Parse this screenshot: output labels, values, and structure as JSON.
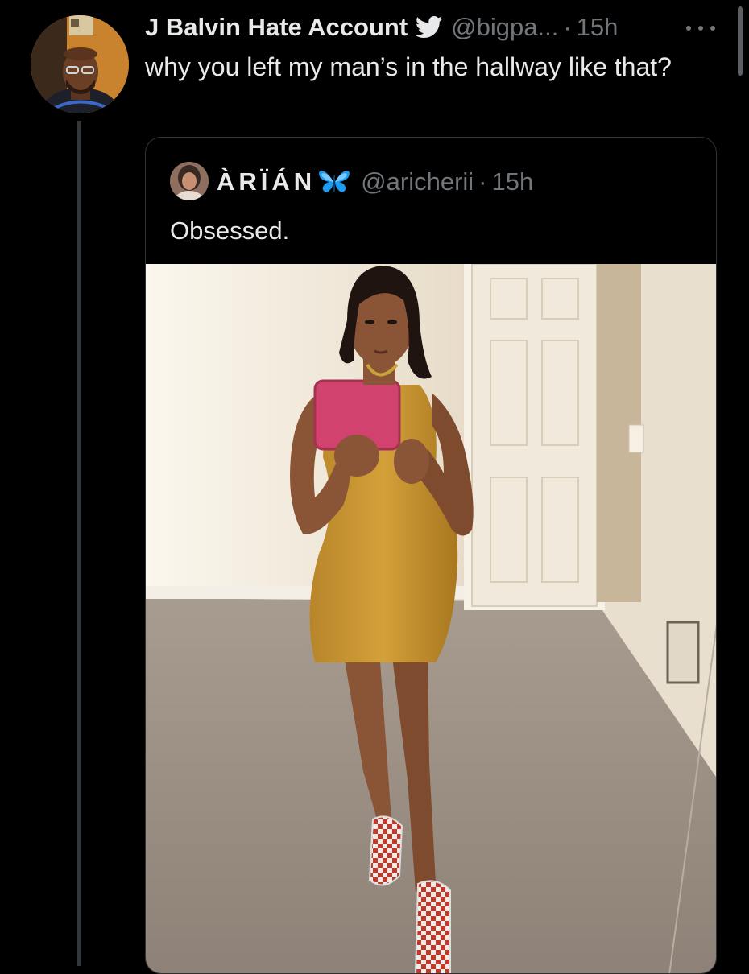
{
  "tweet": {
    "author_name": "J Balvin Hate Account",
    "author_handle": "@bigpa...",
    "separator": "·",
    "timestamp": "15h",
    "text": "why you left my man’s in the hallway like that?",
    "verified_icon": "twitter-bird-icon",
    "more_icon": "more-icon"
  },
  "quoted_tweet": {
    "author_name": "ÀRÏÁN",
    "author_emoji": "🦋",
    "author_handle": "@aricherii",
    "separator": "·",
    "timestamp": "15h",
    "text": "Obsessed.",
    "media": {
      "kind": "photo"
    }
  },
  "colors": {
    "background": "#000000",
    "text_primary": "#e7e9ea",
    "text_secondary": "#71767b",
    "border": "#2f3336",
    "verified_blue": "#1d9bf0"
  }
}
